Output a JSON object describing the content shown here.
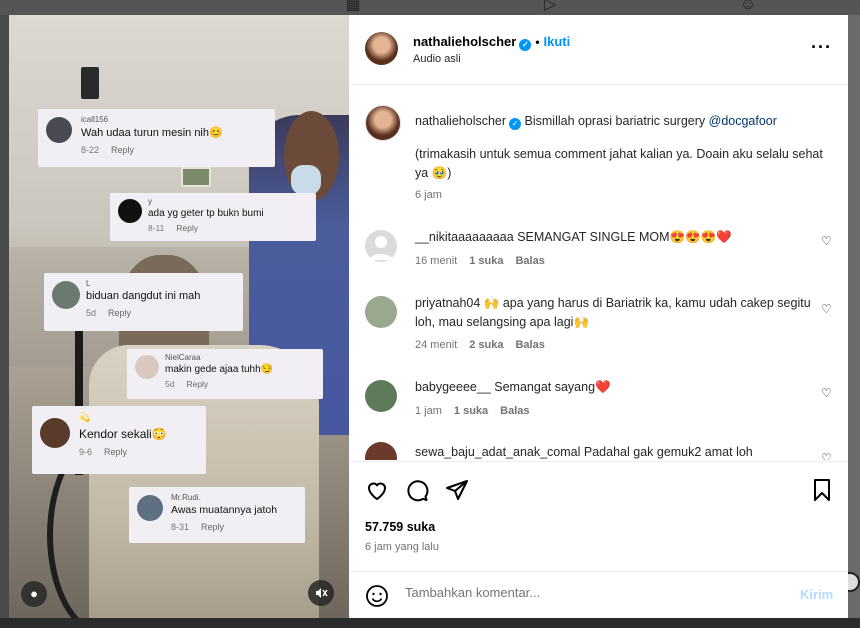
{
  "media": {
    "tiktok_comments": [
      {
        "user": "icall156",
        "text": "Wah udaa turun mesin nih😊",
        "date": "8-22",
        "reply": "Reply"
      },
      {
        "user": "y",
        "text": "ada yg geter tp bukn bumi",
        "date": "8-11",
        "reply": "Reply"
      },
      {
        "user": "L",
        "text": "biduan dangdut ini mah",
        "date": "5d",
        "reply": "Reply"
      },
      {
        "user": "NielCaraa",
        "text": "makin gede ajaa tuhh😏",
        "date": "5d",
        "reply": "Reply"
      },
      {
        "user": "💫",
        "text": "Kendor sekali😳",
        "date": "9-6",
        "reply": "Reply"
      },
      {
        "user": "Mr.Rudi.",
        "text": "Awas muatannya jatoh",
        "date": "8-31",
        "reply": "Reply"
      }
    ],
    "user_tag_icon": "person-icon",
    "mute_icon": "speaker-muted-icon"
  },
  "header": {
    "username": "nathalieholscher",
    "separator": "•",
    "follow_label": "Ikuti",
    "subtitle": "Audio asli",
    "more_icon": "more-horizontal-icon"
  },
  "caption": {
    "username": "nathalieholscher",
    "text": "Bismillah oprasi bariatric surgery",
    "mention": "@docgafoor",
    "text2": "(trimakasih untuk semua comment jahat kalian ya. Doain aku selalu sehat ya 🥹)",
    "time": "6 jam"
  },
  "comments": [
    {
      "username": "__nikitaaaaaaaaa",
      "text": "SEMANGAT SINGLE MOM😍😍😍❤️",
      "time": "16 menit",
      "likes": "1 suka",
      "reply": "Balas"
    },
    {
      "username": "priyatnah04",
      "text": "🙌 apa yang harus di Bariatrik ka, kamu udah cakep segitu loh, mau selangsing apa lagi🙌",
      "time": "24 menit",
      "likes": "2 suka",
      "reply": "Balas"
    },
    {
      "username": "babygeeee__",
      "text": "Semangat sayang❤️",
      "time": "1 jam",
      "likes": "1 suka",
      "reply": "Balas"
    },
    {
      "username": "sewa_baju_adat_anak_comal",
      "text": "Padahal gak gemuk2 amat loh",
      "time": "",
      "likes": "",
      "reply": ""
    }
  ],
  "actions": {
    "likes": "57.759 suka",
    "posted": "6 jam yang lalu"
  },
  "add_comment": {
    "placeholder": "Tambahkan komentar...",
    "post_label": "Kirim"
  },
  "colors": {
    "accent": "#0095f6",
    "post_disabled": "#b3dbff",
    "muted_text": "#737373"
  }
}
